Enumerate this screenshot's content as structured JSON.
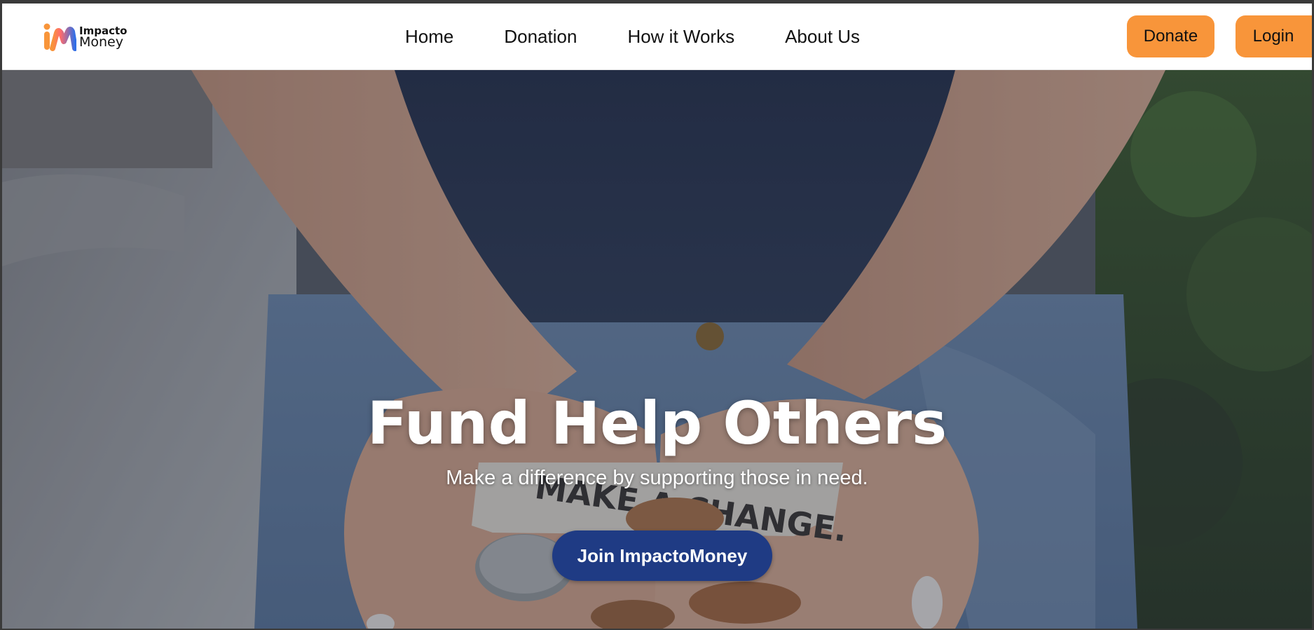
{
  "brand": {
    "name_top": "Impacto",
    "name_bottom": "Money",
    "colors": {
      "blue": "#2f6fe8",
      "orange": "#f8953a"
    }
  },
  "nav": {
    "links": [
      {
        "label": "Home"
      },
      {
        "label": "Donation"
      },
      {
        "label": "How it Works"
      },
      {
        "label": "About Us"
      }
    ],
    "donate_label": "Donate",
    "login_label": "Login"
  },
  "hero": {
    "title": "Fund Help Others",
    "subtitle": "Make a difference by supporting those in need.",
    "cta_label": "Join ImpactoMoney",
    "note_text": "MAKE A CHANGE."
  },
  "colors": {
    "accent_orange": "#f8953a",
    "cta_navy": "#1f3b84",
    "nav_bg": "#ffffff"
  }
}
